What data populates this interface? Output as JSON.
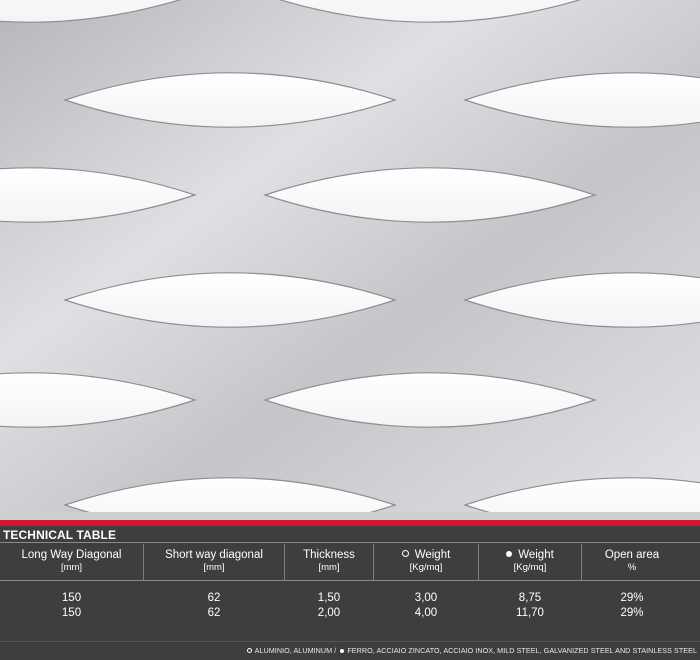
{
  "technical_table": {
    "title": "TECHNICAL TABLE",
    "columns": [
      {
        "label": "Long Way Diagonal",
        "unit": "[mm]"
      },
      {
        "label": "Short way diagonal",
        "unit": "[mm]"
      },
      {
        "label": "Thickness",
        "unit": "[mm]"
      },
      {
        "label": "Weight",
        "unit": "[Kg/mq]",
        "marker": "open-circle-icon"
      },
      {
        "label": "Weight",
        "unit": "[Kg/mq]",
        "marker": "filled-circle-icon"
      },
      {
        "label": "Open area",
        "unit": "%"
      }
    ],
    "rows": [
      [
        "150",
        "62",
        "1,50",
        "3,00",
        "8,75",
        "29%"
      ],
      [
        "150",
        "62",
        "2,00",
        "4,00",
        "11,70",
        "29%"
      ]
    ]
  },
  "legend": {
    "aluminium": "ALUMINIO, ALUMINUM /",
    "steel": "FERRO, ACCIAIO ZINCATO, ACCIAIO INOX, MILD STEEL, GALVANIZED STEEL AND STAINLESS STEEL"
  },
  "colors": {
    "accent": "#d0182c",
    "background": "#3e3e40"
  }
}
